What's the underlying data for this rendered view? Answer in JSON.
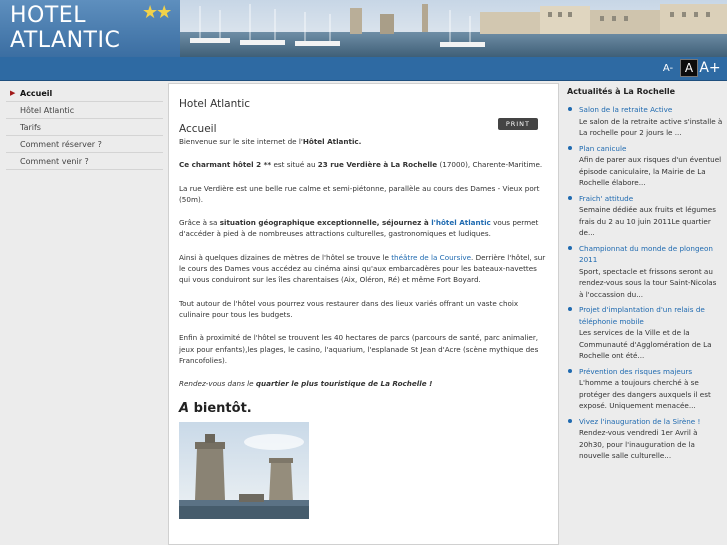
{
  "header": {
    "logo_line1": "HOTEL",
    "logo_line2": "ATLANTIC",
    "logo_stars": "★★"
  },
  "font_controls": {
    "small": "A-",
    "medium": "A",
    "large": "A+"
  },
  "sidebar": {
    "items": [
      {
        "label": "Accueil",
        "active": true
      },
      {
        "label": "Hôtel Atlantic"
      },
      {
        "label": "Tarifs"
      },
      {
        "label": "Comment réserver ?"
      },
      {
        "label": "Comment venir ?"
      }
    ]
  },
  "main": {
    "heading": "Hotel Atlantic",
    "subheading": "Accueil",
    "print_label": "PRINT",
    "p1_a": "Bienvenue sur le site internet de l'",
    "p1_b": "Hôtel Atlantic.",
    "p2_a": "Ce charmant hôtel 2 **",
    "p2_b": " est situé au ",
    "p2_c": "23 rue Verdière à La Rochelle",
    "p2_d": " (17000), Charente-Maritime.",
    "p3": "La rue Verdière est une belle rue calme et semi-piétonne, parallèle au cours des Dames - Vieux port (50m).",
    "p4_a": "Grâce à sa ",
    "p4_b": "situation géographique exceptionnelle, séjournez à",
    "p4_c": " l'hôtel Atlantic",
    "p4_d": " vous permet d'accéder à pied à de nombreuses attractions culturelles, gastronomiques et ludiques.",
    "p5_a": "Ainsi à quelques dizaines de mètres de l'hôtel se trouve le ",
    "p5_b": "théâtre de la Coursive",
    "p5_c": ". Derrière l'hôtel, sur le cours des Dames vous accédez au cinéma ainsi qu'aux embarcadères pour les bateaux-navettes qui vous conduiront sur les îles charentaises (Aix, Oléron, Ré) et même Fort Boyard.",
    "p6": "Tout autour de l'hôtel vous pourrez vous restaurer dans des lieux variés offrant un vaste choix culinaire pour tous les budgets.",
    "p7": "Enfin à proximité de l'hôtel se trouvent les 40 hectares de parcs (parcours de santé, parc animalier, jeux pour enfants),les plages, le casino, l'aquarium, l'esplanade St Jean d'Acre (scène mythique des Francofolies).",
    "p8_a": "Rendez-vous dans le ",
    "p8_b": "quartier le plus touristique de La Rochelle !",
    "abientot_a": "A",
    "abientot_b": " bientôt."
  },
  "news": {
    "title": "Actualités à La Rochelle",
    "items": [
      {
        "title": "Salon de la retraite Active",
        "desc": "Le salon de la retraite active s'installe à La rochelle pour 2 jours le ..."
      },
      {
        "title": "Plan canicule",
        "desc": "Afin de parer aux risques d'un éventuel épisode caniculaire, la Mairie de La Rochelle élabore..."
      },
      {
        "title": "Fraich' attitude",
        "desc": "Semaine dédiée aux fruits et légumes frais du 2 au 10 juin 2011Le quartier de..."
      },
      {
        "title": "Championnat du monde de plongeon 2011",
        "desc": "Sport, spectacle et frissons seront au rendez-vous sous la tour Saint-Nicolas à l'occassion du..."
      },
      {
        "title": "Projet d'implantation d'un relais de téléphonie mobile",
        "desc": "Les services de la Ville et de la Communauté d'Agglomération de La Rochelle ont été..."
      },
      {
        "title": "Prévention des risques majeurs",
        "desc": "L'homme a toujours cherché à se protéger des dangers auxquels il est exposé. Uniquement menacée..."
      },
      {
        "title": "Vivez l'inauguration de la Sirène !",
        "desc": "Rendez-vous vendredi 1er Avril à 20h30, pour l'inauguration de la nouvelle salle culturelle..."
      }
    ]
  }
}
